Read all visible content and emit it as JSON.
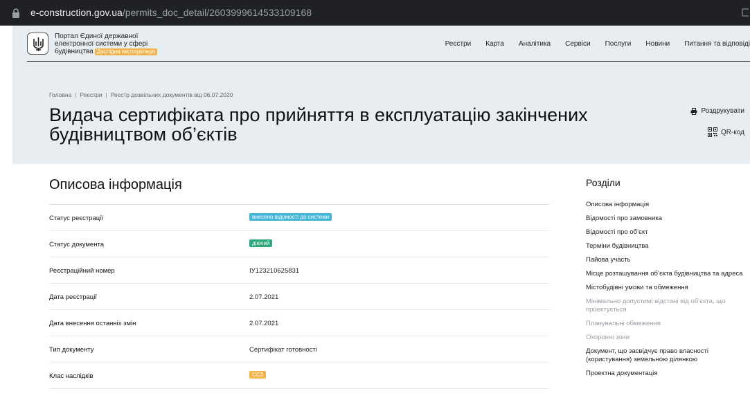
{
  "browser": {
    "url_host": "e-construction.gov.ua",
    "url_path": "/permits_doc_detail/2603999614533109168"
  },
  "header": {
    "portal_name_line1": "Портал Єдиної державної",
    "portal_name_line2": "електронної системи у сфері",
    "portal_name_line3": "будівництва",
    "beta_label": "Дослідна експлуатація",
    "nav": [
      "Реєстри",
      "Карта",
      "Аналітика",
      "Сервіси",
      "Послуги",
      "Новини",
      "Питання та відповіді"
    ]
  },
  "breadcrumb": [
    "Головна",
    "Реєстри",
    "Реєстр дозвільних документів від 06.07.2020"
  ],
  "page_title": "Видача сертифіката про прийняття в експлуатацію закінчених будівництвом об’єктів",
  "tools": {
    "print_label": "Роздрукувати",
    "qr_label": "QR-код"
  },
  "main": {
    "section_title": "Описова інформація",
    "rows": [
      {
        "label": "Статус реєстрації",
        "value": "внесено відомості до системи",
        "badge": "blue"
      },
      {
        "label": "Статус документа",
        "value": "діючий",
        "badge": "green"
      },
      {
        "label": "Реєстраційний номер",
        "value": "ІУ123210625831",
        "badge": ""
      },
      {
        "label": "Дата реєстрації",
        "value": "2.07.2021",
        "badge": ""
      },
      {
        "label": "Дата внесення останніх змін",
        "value": "2.07.2021",
        "badge": ""
      },
      {
        "label": "Тип документу",
        "value": "Сертифікат готовності",
        "badge": ""
      },
      {
        "label": "Клас наслідків",
        "value": "СС3",
        "badge": "orange"
      }
    ]
  },
  "sidebar": {
    "title": "Розділи",
    "items": [
      {
        "label": "Описова інформація",
        "dim": false
      },
      {
        "label": "Відомості про замовника",
        "dim": false
      },
      {
        "label": "Відомості про об’єкт",
        "dim": false
      },
      {
        "label": "Терміни будівництва",
        "dim": false
      },
      {
        "label": "Пайова участь",
        "dim": false
      },
      {
        "label": "Місце розташування об’єкта будівництва та адреса",
        "dim": false
      },
      {
        "label": "Містобудівні умови та обмеження",
        "dim": false
      },
      {
        "label": "Мінімально допустимі відстані від об’єкта, що проектується",
        "dim": true
      },
      {
        "label": "Планувальні обмеження",
        "dim": true
      },
      {
        "label": "Охоронні зони",
        "dim": true
      },
      {
        "label": "Документ, що засвідчує право власності (користування) земельною ділянкою",
        "dim": false
      },
      {
        "label": "Проектна документація",
        "dim": false
      }
    ]
  }
}
